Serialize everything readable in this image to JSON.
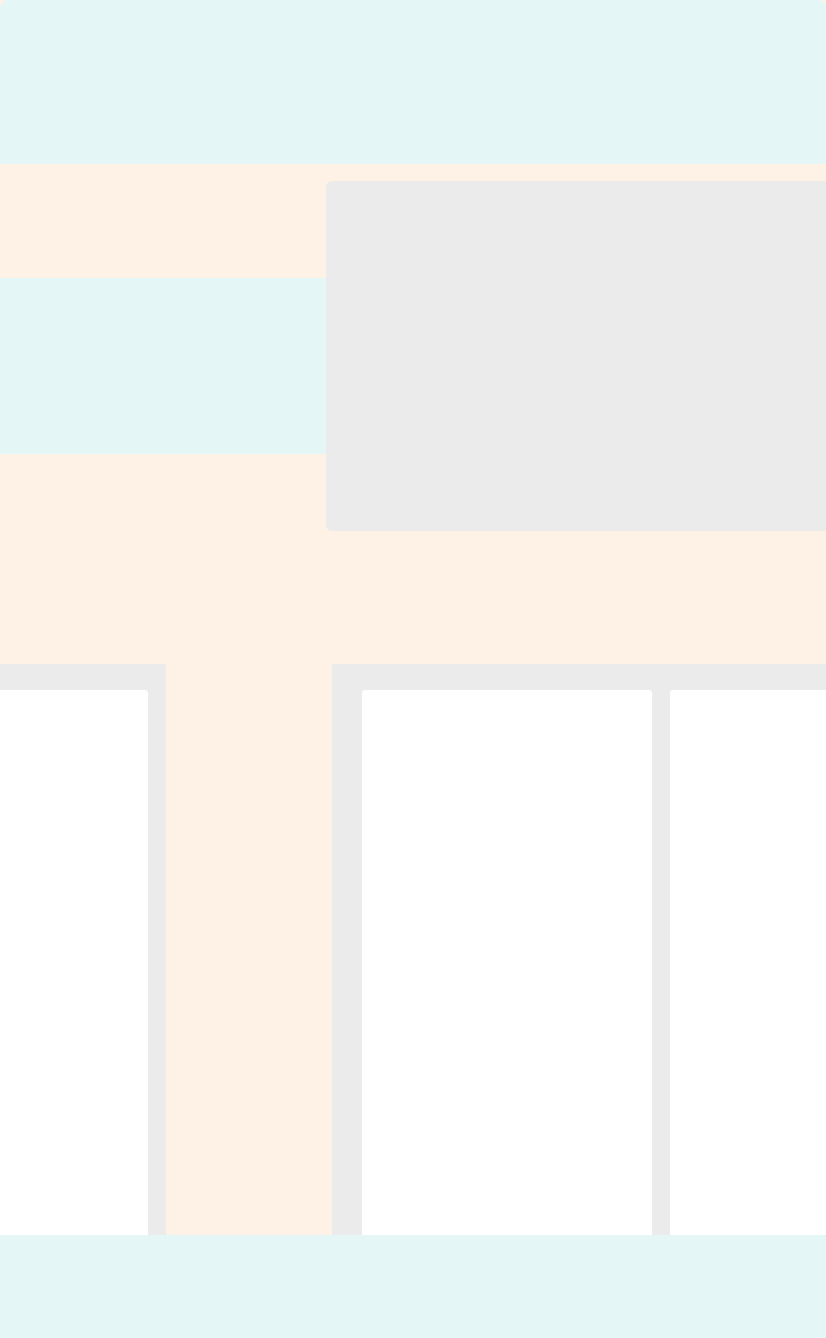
{
  "colors": {
    "mint": "#e4f7f6",
    "cream": "#fef2e6",
    "placeholder_gray": "#ebebeb",
    "card_white": "#ffffff"
  },
  "state": "loading-skeleton"
}
